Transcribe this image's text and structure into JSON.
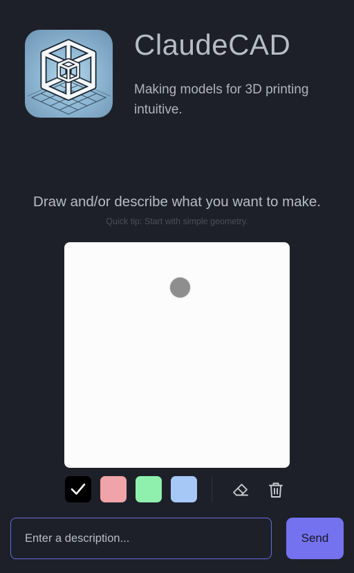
{
  "header": {
    "app_title": "ClaudeCAD",
    "tagline": "Making models for 3D printing intuitive.",
    "logo_icon": "wireframe-cube-icon"
  },
  "drawing": {
    "prompt": "Draw and/or describe what you want to make.",
    "tip": "Quick tip: Start with simple geometry."
  },
  "palette": {
    "colors": [
      {
        "name": "black",
        "hex": "#000000",
        "selected": true
      },
      {
        "name": "red",
        "hex": "#f0a3a8",
        "selected": false
      },
      {
        "name": "green",
        "hex": "#8ff0ae",
        "selected": false
      },
      {
        "name": "blue",
        "hex": "#a6c8f7",
        "selected": false
      }
    ],
    "tools": [
      "eraser-icon",
      "trash-icon"
    ]
  },
  "composer": {
    "placeholder": "Enter a description...",
    "value": "",
    "send_label": "Send"
  },
  "theme": {
    "background": "#1e2029",
    "accent": "#7472ef",
    "input_border": "#6f6adf"
  }
}
